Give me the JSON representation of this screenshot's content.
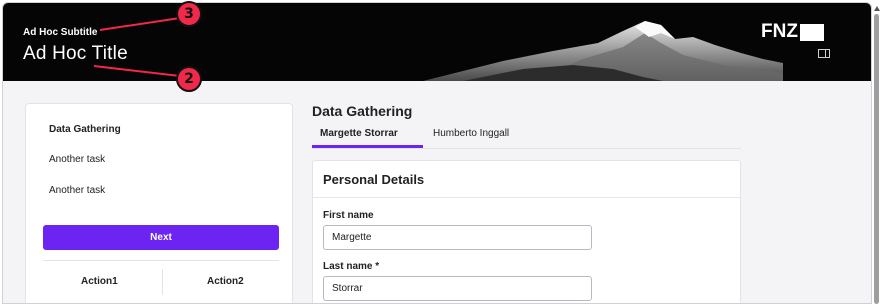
{
  "header": {
    "subtitle": "Ad Hoc Subtitle",
    "title": "Ad Hoc Title",
    "logo_text": "FNZ",
    "panel_icon": "panel-toggle-icon"
  },
  "annotations": {
    "badge_3": "3",
    "badge_2": "2"
  },
  "sidebar": {
    "tasks": [
      {
        "label": "Data Gathering",
        "active": true
      },
      {
        "label": "Another task"
      },
      {
        "label": "Another task"
      }
    ],
    "next_label": "Next",
    "actions": [
      "Action1",
      "Action2"
    ]
  },
  "main": {
    "heading": "Data Gathering",
    "tabs": [
      {
        "label": "Margette Storrar",
        "active": true
      },
      {
        "label": "Humberto Inggall"
      }
    ],
    "card": {
      "title": "Personal Details",
      "fields": [
        {
          "label": "First name",
          "value": "Margette"
        },
        {
          "label": "Last name *",
          "value": "Storrar"
        }
      ]
    }
  },
  "colors": {
    "accent": "#6c24f2",
    "badge": "#f0284a",
    "hero_bg": "#050505"
  }
}
